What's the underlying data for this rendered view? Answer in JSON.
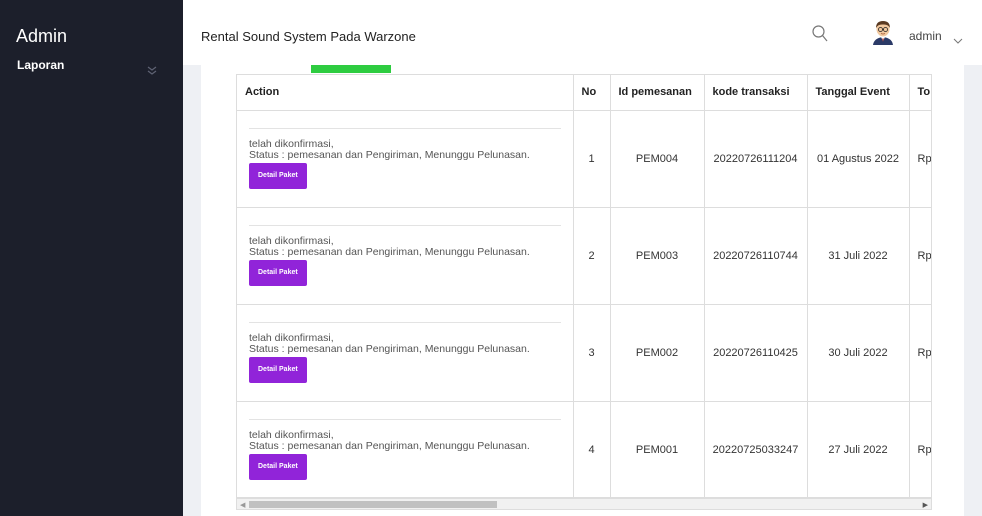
{
  "sidebar": {
    "brand": "Admin",
    "items": [
      {
        "label": "Laporan",
        "icon": "chevron-double-down-icon"
      }
    ]
  },
  "header": {
    "title": "Rental Sound System Pada Warzone",
    "user": "admin",
    "search_icon": "search-icon",
    "avatar_icon": "avatar-icon"
  },
  "colors": {
    "sidebar_bg": "#1c1f2b",
    "button_purple": "#9124d9",
    "button_green": "#2ecc40",
    "content_bg": "#eef0f4"
  },
  "table": {
    "columns": [
      "Action",
      "No",
      "Id pemesanan",
      "kode transaksi",
      "Tanggal Event",
      "To"
    ],
    "rows": [
      {
        "status_1": "telah dikonfirmasi,",
        "status_2": "Status : pemesanan dan Pengiriman, Menunggu Pelunasan.",
        "button": "Detail Paket",
        "no": "1",
        "id": "PEM004",
        "kode": "20220726111204",
        "tanggal": "01 Agustus 2022",
        "total": "Rp"
      },
      {
        "status_1": "telah dikonfirmasi,",
        "status_2": "Status : pemesanan dan Pengiriman, Menunggu Pelunasan.",
        "button": "Detail Paket",
        "no": "2",
        "id": "PEM003",
        "kode": "20220726110744",
        "tanggal": "31 Juli 2022",
        "total": "Rp"
      },
      {
        "status_1": "telah dikonfirmasi,",
        "status_2": "Status : pemesanan dan Pengiriman, Menunggu Pelunasan.",
        "button": "Detail Paket",
        "no": "3",
        "id": "PEM002",
        "kode": "20220726110425",
        "tanggal": "30 Juli 2022",
        "total": "Rp"
      },
      {
        "status_1": "telah dikonfirmasi,",
        "status_2": "Status : pemesanan dan Pengiriman, Menunggu Pelunasan.",
        "button": "Detail Paket",
        "no": "4",
        "id": "PEM001",
        "kode": "20220725033247",
        "tanggal": "27 Juli 2022",
        "total": "Rp"
      }
    ]
  }
}
